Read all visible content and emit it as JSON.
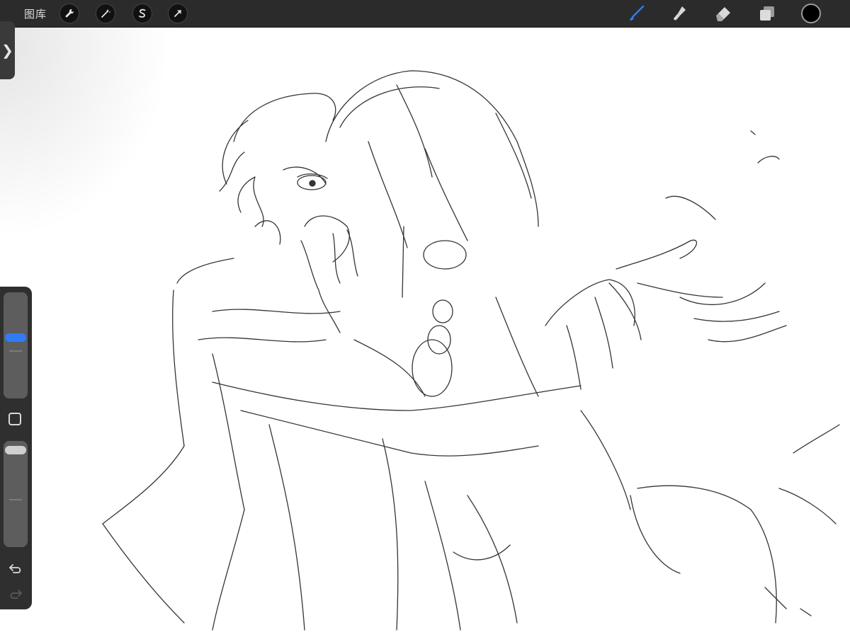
{
  "toolbar": {
    "gallery_label": "图库",
    "left_tools": [
      {
        "name": "actions",
        "icon": "wrench-icon"
      },
      {
        "name": "adjustments",
        "icon": "magic-wand-icon"
      },
      {
        "name": "selection",
        "icon": "selection-s-icon"
      },
      {
        "name": "transform",
        "icon": "arrow-cursor-icon"
      }
    ],
    "right_tools": [
      {
        "name": "brush",
        "icon": "brush-icon",
        "active": true
      },
      {
        "name": "smudge",
        "icon": "smudge-icon",
        "active": false
      },
      {
        "name": "eraser",
        "icon": "eraser-icon",
        "active": false
      },
      {
        "name": "layers",
        "icon": "layers-icon",
        "active": false
      }
    ],
    "current_color": "#000000"
  },
  "sidebar": {
    "brush_size_level": 0.58,
    "opacity_level": 0.95,
    "accent_color": "#2f7cf6"
  },
  "colors": {
    "toolbar_bg": "#2b2b2b",
    "sidebar_bg": "#2f2f2f",
    "canvas_bg": "#ffffff",
    "active_tool": "#2f7cf6"
  }
}
